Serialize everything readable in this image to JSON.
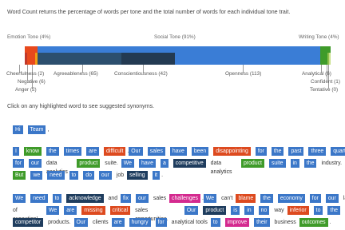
{
  "intro_text": "Word Count returns the percentage of words per tone and the total number of words for each individual tone trait.",
  "tone_bar": {
    "tones": [
      {
        "label": "Emotion Tone (4%)",
        "percent": 4
      },
      {
        "label": "Social Tone (91%)",
        "percent": 91
      },
      {
        "label": "Writing Tone (4%)",
        "percent": 4
      }
    ],
    "traits": [
      {
        "label": "Cheerfulness (2)",
        "count": 2,
        "color": "#c0392b"
      },
      {
        "label": "Negative (6)",
        "count": 6,
        "color": "#e8491d"
      },
      {
        "label": "Anger (2)",
        "count": 2,
        "color": "#f39c12"
      },
      {
        "label": "Agreeableness (65)",
        "count": 65,
        "color": "#2c4f6e"
      },
      {
        "label": "Conscientiousness (42)",
        "count": 42,
        "color": "#233a52"
      },
      {
        "label": "Openness (113)",
        "count": 113,
        "color": "#3a7dd6"
      },
      {
        "label": "Analytical (6)",
        "count": 6,
        "color": "#3f9b2a"
      },
      {
        "label": "Confident (1)",
        "count": 1,
        "color": "#8fbf4a"
      },
      {
        "label": "Tentative (0)",
        "count": 0,
        "color": "#c8e08c"
      }
    ]
  },
  "hint_text": "Click on any highlighted word to see suggested synonyms.",
  "paragraph_1": [
    [
      [
        "Hi",
        "blue"
      ],
      [
        "Team",
        "blue"
      ],
      [
        ",",
        "dot"
      ]
    ]
  ],
  "paragraph_2": [
    [
      [
        "I",
        "blue"
      ],
      [
        "know",
        "green"
      ],
      [
        "the",
        "blue"
      ],
      [
        "times",
        "blue"
      ],
      [
        "are",
        "blue"
      ],
      [
        "difficult",
        "orange"
      ],
      [
        ".",
        "dot"
      ],
      [
        "Our",
        "blue"
      ],
      [
        "sales",
        "blue"
      ],
      [
        "have",
        "blue"
      ],
      [
        "been",
        "blue"
      ],
      [
        "disappointing",
        "orange"
      ],
      [
        "for",
        "blue"
      ],
      [
        "the",
        "blue"
      ],
      [
        "past",
        "blue"
      ],
      [
        "three",
        "blue"
      ],
      [
        "quarters",
        "blue"
      ]
    ],
    [
      [
        "for",
        "blue"
      ],
      [
        "our",
        "blue"
      ],
      [
        "data analytics",
        "plain"
      ],
      [
        "product",
        "green"
      ],
      [
        "suite.",
        "plain"
      ],
      [
        "We",
        "blue"
      ],
      [
        "have",
        "blue"
      ],
      [
        "a",
        "blue"
      ],
      [
        "competitive",
        "navy"
      ],
      [
        "data analytics",
        "plain"
      ],
      [
        "product",
        "green"
      ],
      [
        "suite",
        "blue"
      ],
      [
        "in",
        "blue"
      ],
      [
        "the",
        "blue"
      ],
      [
        "industry.",
        "plain"
      ]
    ],
    [
      [
        "But",
        "green"
      ],
      [
        "we",
        "blue"
      ],
      [
        "need",
        "blue"
      ],
      [
        "to",
        "blue"
      ],
      [
        "do",
        "blue"
      ],
      [
        "our",
        "blue"
      ],
      [
        "job",
        "plain"
      ],
      [
        "selling",
        "navy"
      ],
      [
        "it",
        "blue"
      ],
      [
        ".",
        "dot"
      ]
    ]
  ],
  "paragraph_3": [
    [
      [
        "We",
        "blue"
      ],
      [
        "need",
        "blue"
      ],
      [
        "to",
        "blue"
      ],
      [
        "acknowledge",
        "navy"
      ],
      [
        "and",
        "plain"
      ],
      [
        "fix",
        "blue"
      ],
      [
        "our",
        "blue"
      ],
      [
        "sales",
        "plain"
      ],
      [
        "challenges",
        "magenta"
      ],
      [
        ".",
        "dot"
      ],
      [
        "We",
        "blue"
      ],
      [
        "can't",
        "plain"
      ],
      [
        "blame",
        "orange"
      ],
      [
        "the",
        "blue"
      ],
      [
        "economy",
        "blue"
      ],
      [
        "for",
        "blue"
      ],
      [
        "our",
        "blue"
      ],
      [
        "lack",
        "plain"
      ]
    ],
    [
      [
        "of execution!",
        "plain"
      ],
      [
        "We",
        "blue"
      ],
      [
        "are",
        "blue"
      ],
      [
        "missing",
        "orange"
      ],
      [
        "critical",
        "orange"
      ],
      [
        "sales opportunities.",
        "plain"
      ],
      [
        "Our",
        "blue"
      ],
      [
        "product",
        "navy"
      ],
      [
        "is",
        "blue"
      ],
      [
        "in",
        "blue"
      ],
      [
        "no",
        "blue"
      ],
      [
        "way",
        "plain"
      ],
      [
        "inferior",
        "orange"
      ],
      [
        "to",
        "blue"
      ],
      [
        "the",
        "blue"
      ]
    ],
    [
      [
        "competitor",
        "navy"
      ],
      [
        "products.",
        "plain"
      ],
      [
        "Our",
        "blue"
      ],
      [
        "clients",
        "plain"
      ],
      [
        "are",
        "blue"
      ],
      [
        "hungry",
        "blue"
      ],
      [
        "for",
        "blue"
      ],
      [
        "analytical tools",
        "plain"
      ],
      [
        "to",
        "blue"
      ],
      [
        "improve",
        "magenta"
      ],
      [
        "their",
        "blue"
      ],
      [
        "business",
        "plain"
      ],
      [
        "outcomes",
        "green"
      ],
      [
        ".",
        "dot"
      ]
    ]
  ]
}
